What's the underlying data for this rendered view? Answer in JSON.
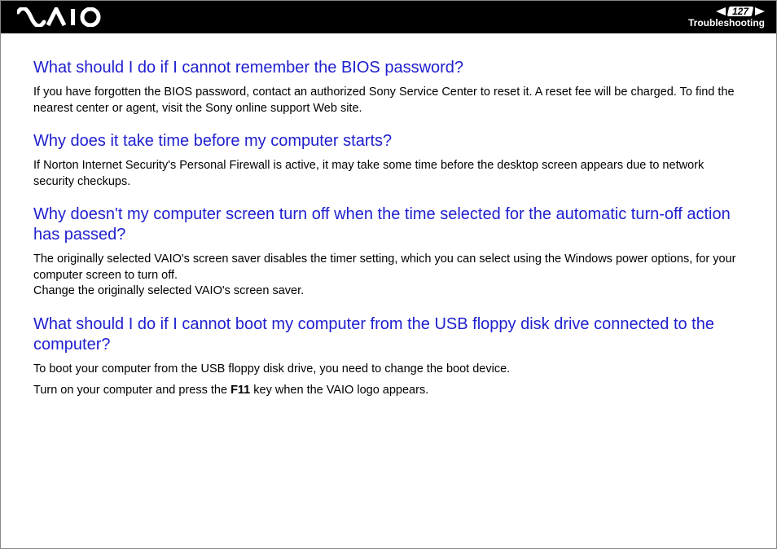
{
  "header": {
    "page_number": "127",
    "section": "Troubleshooting"
  },
  "sections": [
    {
      "heading": "What should I do if I cannot remember the BIOS password?",
      "paragraphs": [
        "If you have forgotten the BIOS password, contact an authorized Sony Service Center to reset it. A reset fee will be charged. To find the nearest center or agent, visit the Sony online support Web site."
      ]
    },
    {
      "heading": "Why does it take time before my computer starts?",
      "paragraphs": [
        "If Norton Internet Security's Personal Firewall is active, it may take some time before the desktop screen appears due to network security checkups."
      ]
    },
    {
      "heading": "Why doesn't my computer screen turn off when the time selected for the automatic turn-off action has passed?",
      "paragraphs": [
        "The originally selected VAIO's screen saver disables the timer setting, which you can select using the Windows power options, for your computer screen to turn off.\nChange the originally selected VAIO's screen saver."
      ]
    },
    {
      "heading": "What should I do if I cannot boot my computer from the USB floppy disk drive connected to the computer?",
      "paragraphs": [
        "To boot your computer from the USB floppy disk drive, you need to change the boot device.",
        "Turn on your computer and press the <b>F11</b> key when the VAIO logo appears."
      ]
    }
  ]
}
